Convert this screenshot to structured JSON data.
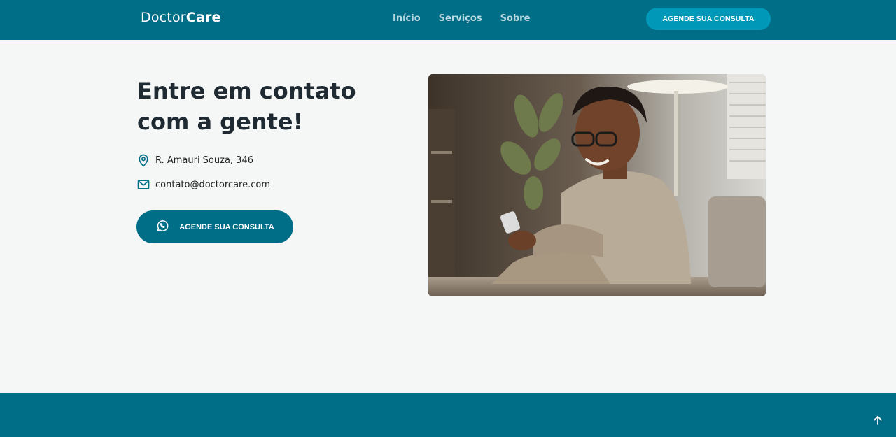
{
  "header": {
    "logo_regular": "Doctor",
    "logo_bold": "Care",
    "nav": [
      "Início",
      "Serviços",
      "Sobre"
    ],
    "cta_label": "AGENDE SUA CONSULTA"
  },
  "contact": {
    "title_line1": "Entre em contato",
    "title_line2": "com a gente!",
    "address": "R. Amauri Souza, 346",
    "email": "contato@doctorcare.com",
    "cta_label": "AGENDE SUA CONSULTA"
  },
  "icons": {
    "address": "map-pin-icon",
    "email": "mail-icon",
    "cta": "whatsapp-icon",
    "back_to_top": "arrow-up-icon"
  },
  "colors": {
    "primary": "#006e87",
    "accent": "#0098b8",
    "background": "#f5f7f6",
    "text": "#1f2a33"
  }
}
